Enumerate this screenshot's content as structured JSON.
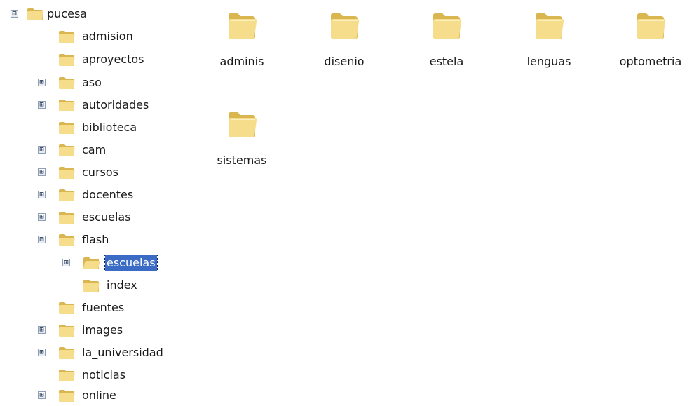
{
  "tree": {
    "root": {
      "label": "pucesa",
      "expander": "⊟"
    },
    "items": [
      {
        "label": "admision",
        "expander": ""
      },
      {
        "label": "aproyectos",
        "expander": ""
      },
      {
        "label": "aso",
        "expander": "⊞"
      },
      {
        "label": "autoridades",
        "expander": "⊞"
      },
      {
        "label": "biblioteca",
        "expander": ""
      },
      {
        "label": "cam",
        "expander": "⊞"
      },
      {
        "label": "cursos",
        "expander": "⊞"
      },
      {
        "label": "docentes",
        "expander": "⊞"
      },
      {
        "label": "escuelas",
        "expander": "⊞"
      },
      {
        "label": "flash",
        "expander": "⊟"
      },
      {
        "label": "escuelas",
        "expander": "⊞",
        "selected": true
      },
      {
        "label": "index",
        "expander": ""
      },
      {
        "label": "fuentes",
        "expander": ""
      },
      {
        "label": "images",
        "expander": "⊞"
      },
      {
        "label": "la_universidad",
        "expander": "⊞"
      },
      {
        "label": "noticias",
        "expander": ""
      },
      {
        "label": "online",
        "expander": "⊞"
      }
    ]
  },
  "pane": {
    "folders": [
      {
        "label": "adminis"
      },
      {
        "label": "disenio"
      },
      {
        "label": "estela"
      },
      {
        "label": "lenguas"
      },
      {
        "label": "optometria"
      },
      {
        "label": "sistemas"
      }
    ]
  },
  "colors": {
    "folder_fill": "#f6dd8c",
    "folder_dark": "#d9b64f",
    "selection": "#3a6bc5"
  },
  "icons": {
    "folder": "folder-icon",
    "expand": "plus-box-icon",
    "collapse": "minus-box-icon"
  }
}
